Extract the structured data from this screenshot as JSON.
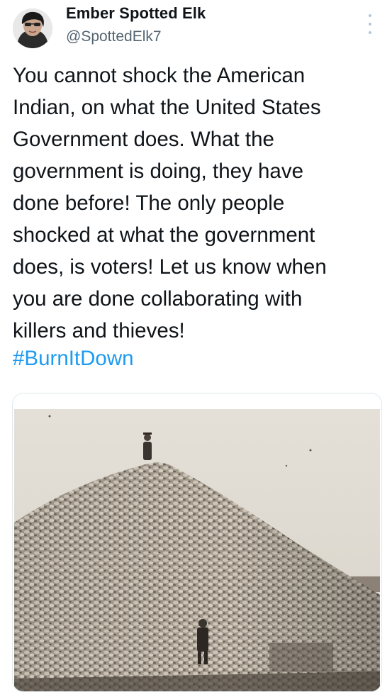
{
  "author": {
    "display_name": "Ember Spotted Elk",
    "handle": "@SpottedElk7",
    "avatar_icon": "profile-photo"
  },
  "menu": {
    "icon": "more-vertical-icon"
  },
  "tweet": {
    "lines": [
      "You cannot shock the American",
      "Indian, on what the United States",
      "Government does. What the",
      "government is doing, they have",
      "done before! The only people",
      "shocked at what the government",
      "does, is voters! Let us know when",
      "you are done collaborating with",
      "killers and thieves!"
    ],
    "hashtag": "#BurnItDown"
  },
  "media": {
    "kind": "sepia historical photograph of a large pile of bison skulls with two men"
  },
  "colors": {
    "text": "#0f1419",
    "secondary": "#536471",
    "link": "#1d9bf0",
    "card_border": "#e1e8ed"
  }
}
